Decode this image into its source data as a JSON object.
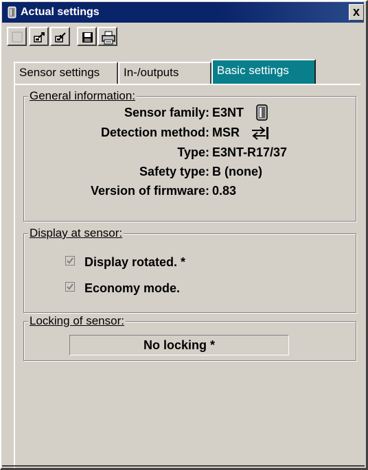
{
  "window": {
    "title": "Actual settings",
    "close_label": "x"
  },
  "toolbar": {
    "buttons": [
      {
        "icon": "blank-icon"
      },
      {
        "icon": "upload-icon"
      },
      {
        "icon": "download-icon"
      },
      {
        "icon": "save-icon"
      },
      {
        "icon": "print-icon"
      }
    ]
  },
  "tabs": [
    {
      "label": "Sensor settings",
      "active": false
    },
    {
      "label": "In-/outputs",
      "active": false
    },
    {
      "label": "Basic settings",
      "active": true
    }
  ],
  "general_information": {
    "legend": "General information:",
    "rows": [
      {
        "label": "Sensor family:",
        "value": "E3NT",
        "icon": "sensor-icon"
      },
      {
        "label": "Detection method:",
        "value": "MSR",
        "icon": "reflect-arrows-icon"
      },
      {
        "label": "Type:",
        "value": "E3NT-R17/37"
      },
      {
        "label": "Safety type:",
        "value": "B (none)"
      },
      {
        "label": "Version of firmware:",
        "value": "0.83"
      }
    ]
  },
  "display_at_sensor": {
    "legend": "Display at sensor:",
    "options": [
      {
        "label": "Display rotated. *",
        "checked": true,
        "enabled": false
      },
      {
        "label": "Economy mode.",
        "checked": true,
        "enabled": false
      }
    ]
  },
  "locking_of_sensor": {
    "legend": "Locking of sensor:",
    "value": "No locking *"
  },
  "colors": {
    "titlebar": "#0a246a",
    "active_tab": "#0a7f8c",
    "face": "#d4d0c8"
  }
}
